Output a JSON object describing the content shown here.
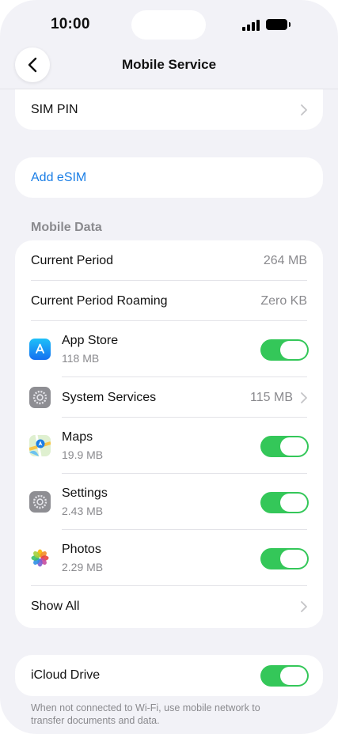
{
  "status_bar": {
    "time": "10:00"
  },
  "nav": {
    "title": "Mobile Service"
  },
  "sim_pin": {
    "label": "SIM PIN"
  },
  "add_esim": {
    "label": "Add eSIM"
  },
  "mobile_data": {
    "header": "Mobile Data",
    "current_period": {
      "label": "Current Period",
      "value": "264 MB"
    },
    "roaming": {
      "label": "Current Period Roaming",
      "value": "Zero KB"
    },
    "apps": [
      {
        "name": "App Store",
        "usage": "118 MB",
        "icon": "app-store-icon",
        "enabled": true
      },
      {
        "name": "System Services",
        "usage": "115 MB",
        "icon": "system-services-icon"
      },
      {
        "name": "Maps",
        "usage": "19.9 MB",
        "icon": "maps-icon",
        "enabled": true
      },
      {
        "name": "Settings",
        "usage": "2.43 MB",
        "icon": "settings-icon",
        "enabled": true
      },
      {
        "name": "Photos",
        "usage": "2.29 MB",
        "icon": "photos-icon",
        "enabled": true
      }
    ],
    "show_all": "Show All"
  },
  "icloud": {
    "label": "iCloud Drive",
    "enabled": true,
    "footnote": "When not connected to Wi-Fi, use mobile network to transfer documents and data."
  },
  "colors": {
    "toggle_on": "#34c759",
    "link": "#1a7ee6",
    "background": "#f2f2f7"
  }
}
